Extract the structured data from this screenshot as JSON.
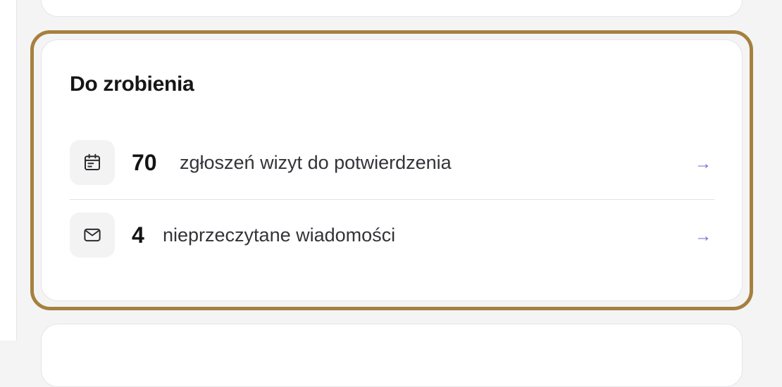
{
  "todo_card": {
    "title": "Do zrobienia",
    "items": [
      {
        "icon": "calendar-icon",
        "count": "70",
        "label": "zgłoszeń wizyt do potwierdzenia",
        "arrow": "→"
      },
      {
        "icon": "mail-icon",
        "count": "4",
        "label": "nieprzeczytane wiadomości",
        "arrow": "→"
      }
    ]
  },
  "colors": {
    "highlight_border": "#a5803f",
    "arrow": "#6d6ad4",
    "icon_bg": "#f3f3f4"
  }
}
